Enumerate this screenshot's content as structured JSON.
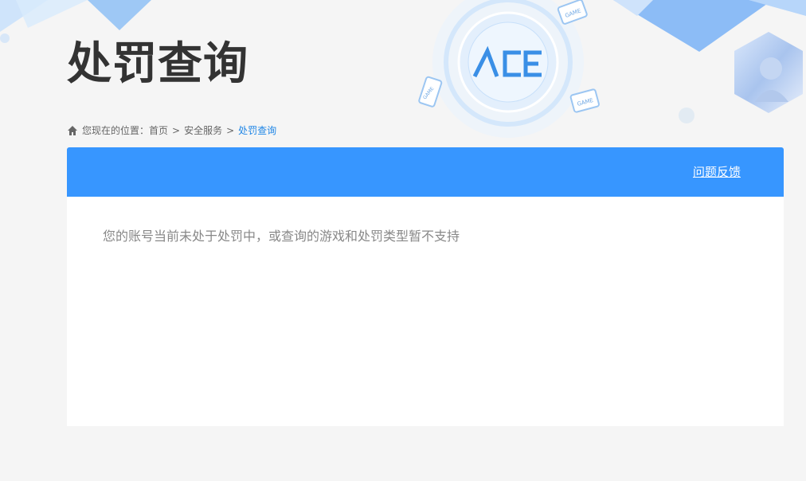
{
  "page": {
    "title": "处罚查询"
  },
  "breadcrumb": {
    "prefix": "您现在的位置：",
    "items": [
      "首页",
      "安全服务",
      "处罚查询"
    ],
    "separator": ">"
  },
  "logo": {
    "text": "ACE"
  },
  "header": {
    "feedback_label": "问题反馈"
  },
  "main": {
    "message": "您的账号当前未处于处罚中，或查询的游戏和处罚类型暂不支持"
  },
  "colors": {
    "header_bar": "#3796ff",
    "breadcrumb_current": "#1f86e6",
    "title": "#333333",
    "message": "#888888"
  }
}
